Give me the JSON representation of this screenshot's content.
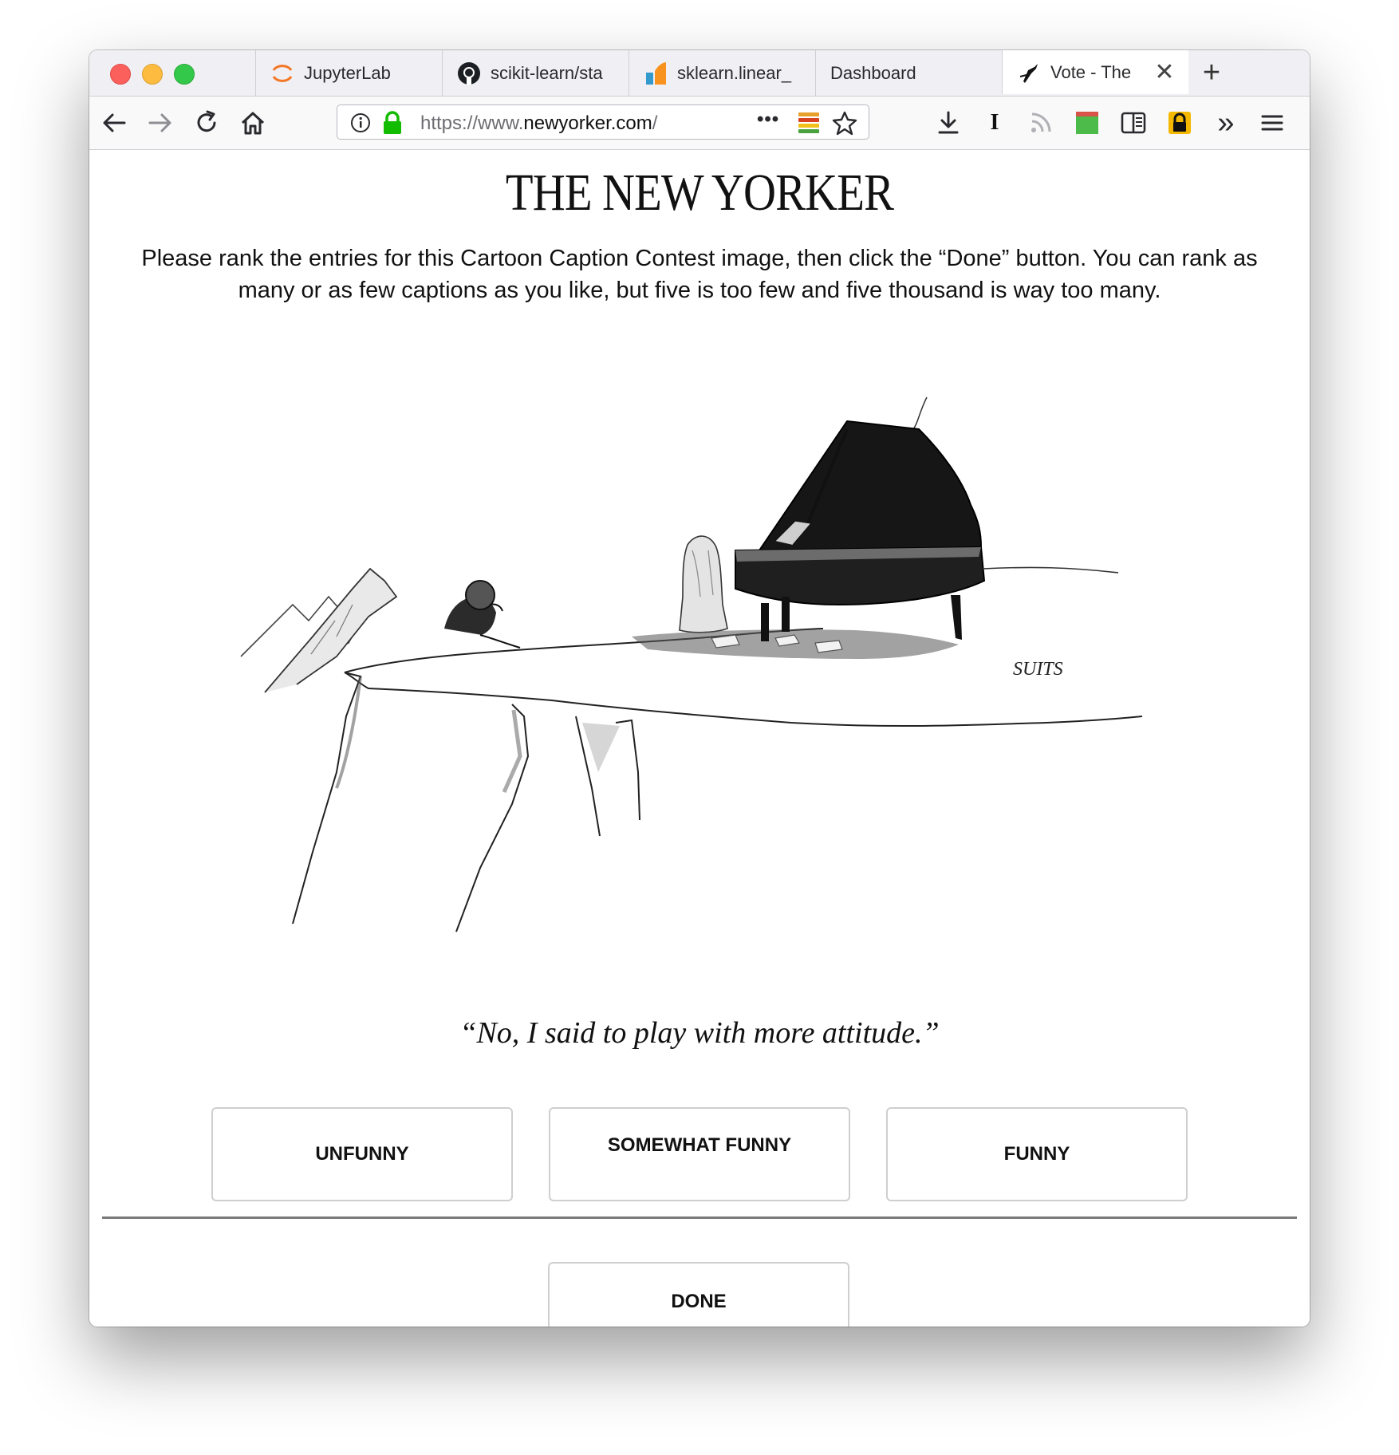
{
  "browser": {
    "tabs": [
      {
        "label": "JupyterLab",
        "icon": "jupyter-icon",
        "active": false
      },
      {
        "label": "scikit-learn/sta",
        "icon": "github-icon",
        "active": false
      },
      {
        "label": "sklearn.linear_",
        "icon": "sklearn-icon",
        "active": false
      },
      {
        "label": "Dashboard",
        "icon": "",
        "active": false
      },
      {
        "label": "Vote - The",
        "icon": "new-yorker-icon",
        "active": true
      }
    ],
    "new_tab_label": "+",
    "close_tab_label": "✕",
    "url": {
      "prefix": "https://www.",
      "host": "newyorker.com",
      "suffix": "/"
    },
    "page_actions_label": "•••",
    "overflow_label": "»",
    "reader_label": "I"
  },
  "page": {
    "logo": "THE NEW YORKER",
    "instructions": "Please rank the entries for this Cartoon Caption Contest image, then click the “Done” button. You can rank as many or as few captions as you like, but five is too few and five thousand is way too many.",
    "cartoon_signature": "SUITS",
    "caption": "“No, I said to play with more attitude.”",
    "buttons": {
      "unfunny": "UNFUNNY",
      "somewhat": "SOMEWHAT FUNNY",
      "funny": "FUNNY",
      "done": "DONE"
    }
  },
  "colors": {
    "active_tab_accent": "#0a84ff",
    "lock_green": "#12bc00"
  }
}
